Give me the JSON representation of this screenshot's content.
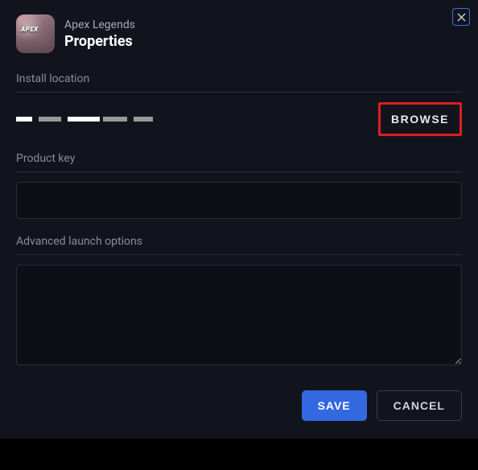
{
  "header": {
    "game_title": "Apex Legends",
    "dialog_title": "Properties",
    "icon_text": "APEX"
  },
  "install": {
    "label": "Install location",
    "browse_label": "BROWSE"
  },
  "product_key": {
    "label": "Product key",
    "value": ""
  },
  "advanced": {
    "label": "Advanced launch options",
    "value": ""
  },
  "footer": {
    "save_label": "SAVE",
    "cancel_label": "CANCEL"
  },
  "colors": {
    "accent": "#3268e0",
    "highlight_border": "#dc1e1e"
  }
}
